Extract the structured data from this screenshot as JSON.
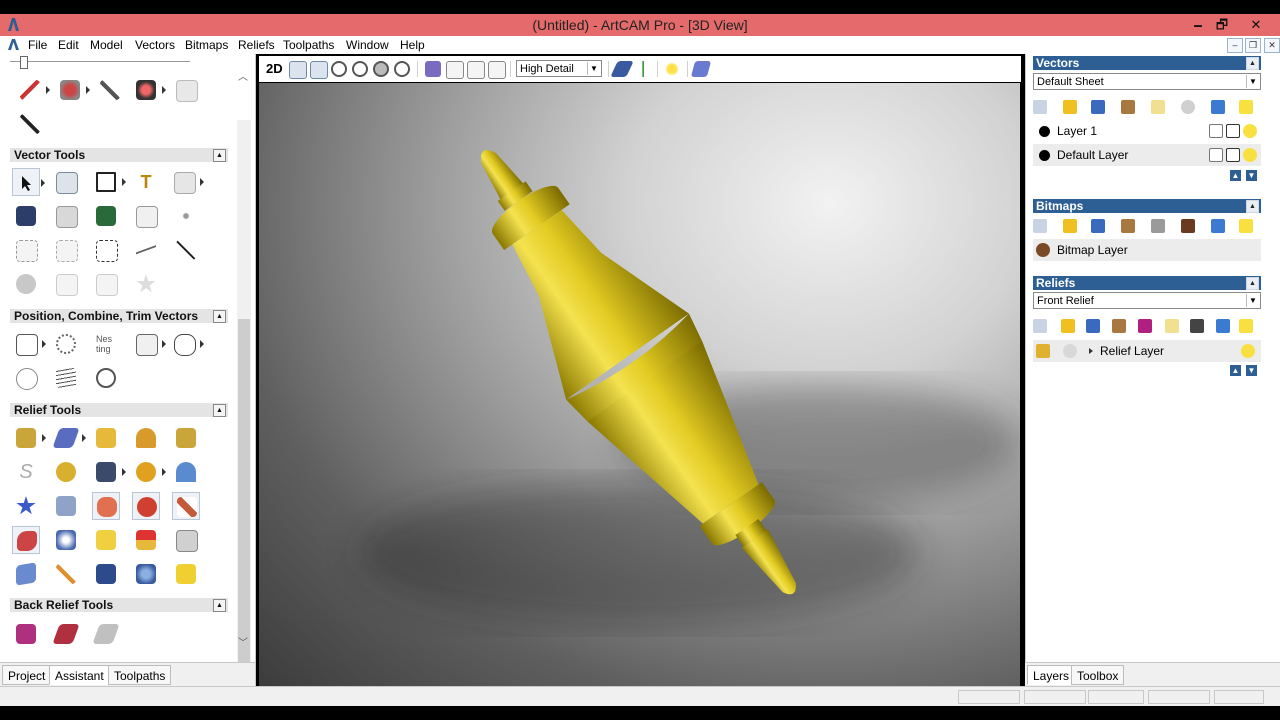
{
  "window": {
    "title": "(Untitled) - ArtCAM Pro - [3D View]",
    "minimize": "🗕",
    "restore": "🗗",
    "close": "✕"
  },
  "menu": [
    "File",
    "Edit",
    "Model",
    "Vectors",
    "Bitmaps",
    "Reliefs",
    "Toolpaths",
    "Window",
    "Help"
  ],
  "left_panel": {
    "sections": {
      "vector_tools": "Vector Tools",
      "position_combine_trim": "Position, Combine, Trim Vectors",
      "relief_tools": "Relief Tools",
      "back_relief_tools": "Back Relief Tools"
    },
    "tabs": [
      "Project",
      "Assistant",
      "Toolpaths"
    ],
    "active_tab": "Assistant"
  },
  "view_toolbar": {
    "mode_2d": "2D",
    "detail_value": "High Detail"
  },
  "right_panel": {
    "vectors": {
      "header": "Vectors",
      "sheet_value": "Default Sheet",
      "layers": [
        "Layer 1",
        "Default Layer"
      ]
    },
    "bitmaps": {
      "header": "Bitmaps",
      "layers": [
        "Bitmap Layer"
      ]
    },
    "reliefs": {
      "header": "Reliefs",
      "relief_value": "Front Relief",
      "layers": [
        "Relief Layer"
      ]
    },
    "tabs": [
      "Layers",
      "Toolbox"
    ],
    "active_tab": "Layers"
  },
  "colors": {
    "title_bar": "#e46a6c",
    "panel_header": "#2d5f94",
    "model_gold": "#d9c21c"
  }
}
